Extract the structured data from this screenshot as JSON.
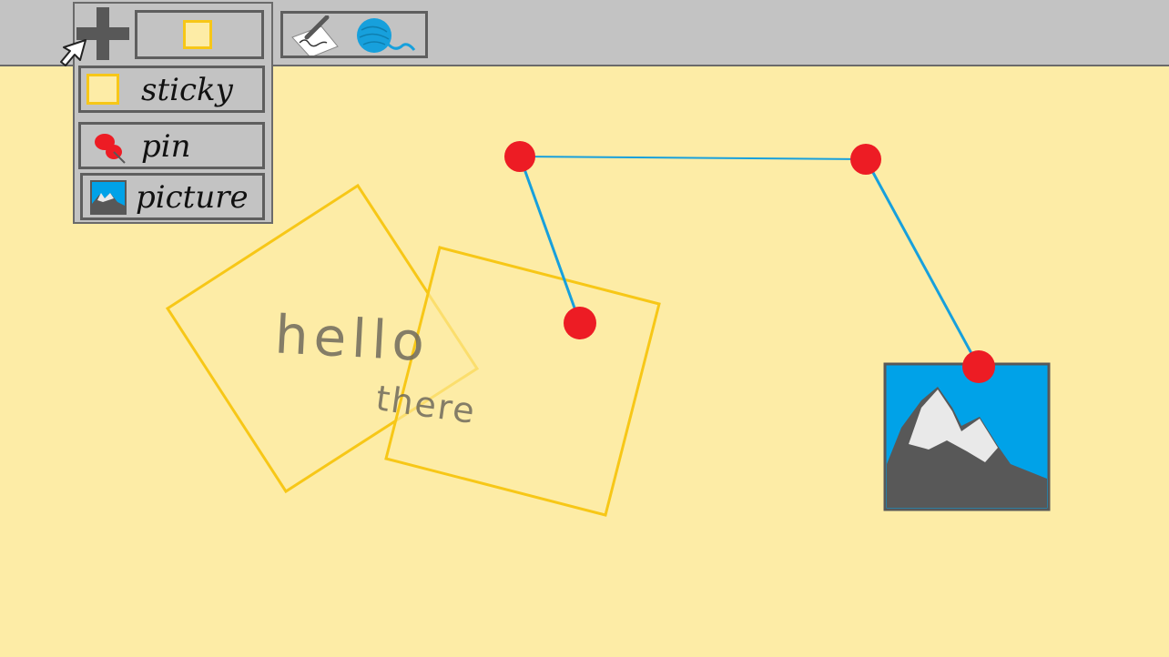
{
  "toolbar": {
    "add_icon": "plus-icon",
    "current_note_icon": "sticky-swatch-icon",
    "draw_icon": "pen-paper-icon",
    "string_icon": "yarn-ball-icon"
  },
  "add_menu": {
    "items": [
      {
        "label": "sticky",
        "icon": "sticky-swatch-icon"
      },
      {
        "label": "pin",
        "icon": "pushpin-icon"
      },
      {
        "label": "picture",
        "icon": "picture-icon"
      }
    ]
  },
  "board": {
    "note_text_1": "hello",
    "note_text_2": "there"
  },
  "colors": {
    "board": "#fdeca6",
    "toolbar": "#c3c3c3",
    "border": "#5e5e5e",
    "note_outline": "#f7c717",
    "pin": "#ed1c24",
    "string": "#17a0dc",
    "picture_sky": "#00a2e8",
    "picture_mountain": "#585858"
  }
}
